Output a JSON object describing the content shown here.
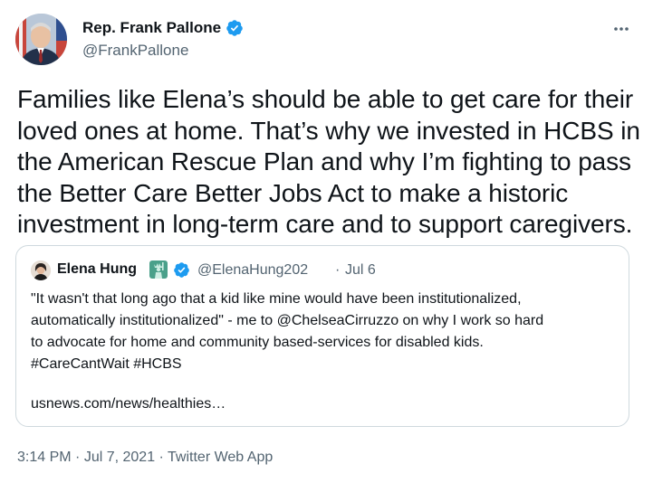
{
  "author": {
    "name": "Rep. Frank Pallone",
    "handle": "@FrankPallone",
    "verified": true,
    "avatar_icon": "avatar-portrait"
  },
  "more_icon_glyph": "···",
  "tweet": {
    "text": "Families like Elena’s should be able to get care for their loved ones at home. That’s why we invested in HCBS in the American Rescue Plan and why I’m fighting to pass the Better Care Better Jobs Act to make a historic investment in long-term care and to support caregivers."
  },
  "quote": {
    "name": "Elena Hung",
    "handle": "@ElenaHung202",
    "separator": "·",
    "date": "Jul 6",
    "emoji_icon": "statue-of-liberty-icon",
    "verified": true,
    "lines": [
      "\"It wasn't that long ago that a kid like mine would have been institutionalized,",
      "automatically institutionalized\" - me to @ChelseaCirruzzo on why I work so hard",
      "to advocate for home and community based-services for disabled kids.",
      "#CareCantWait #HCBS"
    ],
    "link": "usnews.com/news/healthies…"
  },
  "meta": {
    "time": "3:14 PM",
    "sep1": " · ",
    "date": "Jul 7, 2021",
    "sep2": " · ",
    "source": "Twitter Web App"
  },
  "colors": {
    "verified_blue": "#1d9bf0",
    "secondary_text": "#536471",
    "border": "#cfd9de",
    "statue_green": "#4aa08a"
  }
}
